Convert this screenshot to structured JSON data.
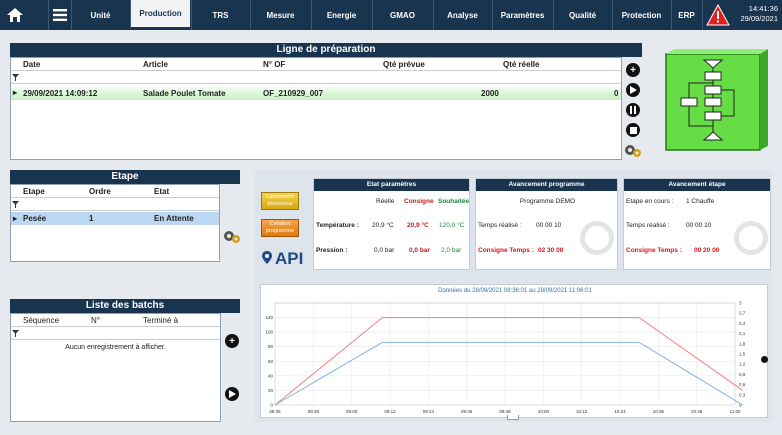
{
  "nav": {
    "items": [
      "Unité",
      "Production",
      "TRS",
      "Mesure",
      "Energie",
      "GMAO",
      "Analyse",
      "Paramètres",
      "Qualité",
      "Protection",
      "ERP"
    ],
    "active": "Production",
    "time": "14:41:36",
    "date": "29/09/2021"
  },
  "ligne": {
    "title": "Ligne de préparation",
    "columns": [
      "Date",
      "Article",
      "N° OF",
      "Qté prévue",
      "Qté réelle"
    ],
    "row": {
      "date": "29/09/2021 14:09:12",
      "article": "Salade Poulet Tomate",
      "of": "OF_210929_007",
      "prevue": "2000",
      "reelle": "0"
    }
  },
  "etape": {
    "title": "Etape",
    "columns": [
      "Etape",
      "Ordre",
      "Etat"
    ],
    "row": {
      "etape": "Pesée",
      "ordre": "1",
      "etat": "En Attente"
    }
  },
  "batchs": {
    "title": "Liste des batchs",
    "columns": [
      "Séquence",
      "N°",
      "Terminé à"
    ],
    "empty": "Aucun enregistrement à afficher."
  },
  "buttons": {
    "lancement": "Lancement processus",
    "creation": "Création programme"
  },
  "logo": "API",
  "etat_param": {
    "title": "Etat paramètres",
    "col_reelle": "Réelle",
    "col_consigne": "Consigne",
    "col_souhaitee": "Souhaitée",
    "temp_label": "Température :",
    "temp_reelle": "20,9 °C",
    "temp_consigne": "20,9 °C",
    "temp_souhaitee": "120,0 °C",
    "press_label": "Pression :",
    "press_reelle": "0,0 bar",
    "press_consigne": "0,0 bar",
    "press_souhaitee": "2,0 bar"
  },
  "avancement_prog": {
    "title": "Avancement programme",
    "name": "Programme DEMO",
    "temps_label": "Temps réalisé :",
    "temps_val": "00 00 10",
    "consigne_label": "Consigne Temps :",
    "consigne_val": "02 30 00"
  },
  "avancement_etape": {
    "title": "Avancement étape",
    "etape_label": "Etape en cours :",
    "etape_val": "1 Chauffe",
    "temps_label": "Temps réalisé :",
    "temps_val": "00 00 10",
    "consigne_label": "Consigne Temps :",
    "consigne_val": "00 20 00"
  },
  "chart_data": {
    "type": "line",
    "title": "Données du 28/09/2021 08:36:01 au 28/09/2021 11:06:01",
    "x": [
      "08:36",
      "08:48",
      "09:00",
      "09:12",
      "09:24",
      "09:36",
      "09:48",
      "10:00",
      "10:12",
      "10:24",
      "10:36",
      "10:48",
      "11:00"
    ],
    "ylim": [
      0,
      140
    ],
    "y_ticks": [
      0,
      20,
      40,
      60,
      80,
      100,
      120
    ],
    "y2lim": [
      0,
      3
    ],
    "y2_ticks": [
      "0",
      "0,3",
      "0,6",
      "0,9",
      "1,2",
      "1,5",
      "1,8",
      "2,1",
      "2,4",
      "2,7",
      "3"
    ],
    "series": [
      {
        "color": "#f08080",
        "points": [
          [
            0,
            0
          ],
          [
            2.8,
            120
          ],
          [
            9.5,
            120
          ],
          [
            12.2,
            20
          ]
        ]
      },
      {
        "color": "#7fb0e6",
        "points": [
          [
            0,
            0
          ],
          [
            2.8,
            86
          ],
          [
            9.5,
            86
          ],
          [
            12.2,
            0
          ]
        ]
      }
    ]
  }
}
